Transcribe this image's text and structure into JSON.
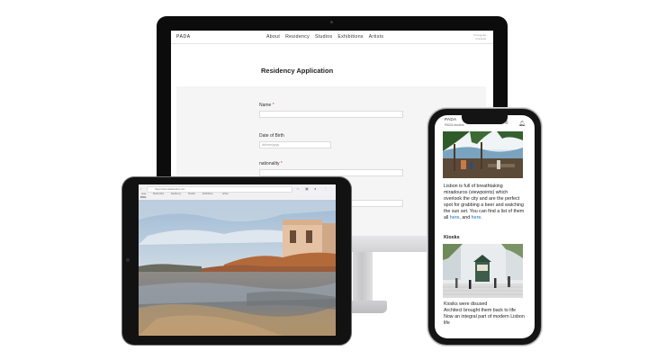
{
  "desktop": {
    "site": {
      "logo": "PADA",
      "nav": [
        "About",
        "Residency",
        "Studios",
        "Exhibitions",
        "Artists"
      ],
      "lang": [
        "Português",
        "Français"
      ]
    },
    "form": {
      "title": "Residency Application",
      "fields": [
        {
          "label": "Name",
          "required": "*",
          "value": ""
        },
        {
          "label": "Date of Birth",
          "required": "",
          "placeholder": "dd/mm/yyyy"
        },
        {
          "label": "nationality",
          "required": "*",
          "value": ""
        }
      ]
    }
  },
  "tablet": {
    "browser": {
      "url": "https://www.padastudios.com",
      "bookmarks": [
        "Apps",
        "Bookmarks",
        "Residency",
        "Studios",
        "Exhibitions",
        "Artists"
      ],
      "site_logo": "PADA"
    }
  },
  "phone": {
    "site": {
      "logo": "PADA",
      "subtitle": "PADA studios"
    },
    "paragraph1": {
      "text": "Lisbon is full of breathtaking miradouros (viewpoints) which overlook the city and are the perfect spot for grabbing a beer and watching the sun set. You can find a list of them all",
      "link1": "here",
      "joiner": ", and",
      "link2": "here",
      "end": "."
    },
    "kiosks": {
      "heading": "Kiosks",
      "line1": "Kiosks were disused",
      "line2": "Architect brought them back to life",
      "line3": "Now an integral part of modern Lisbon life"
    }
  }
}
